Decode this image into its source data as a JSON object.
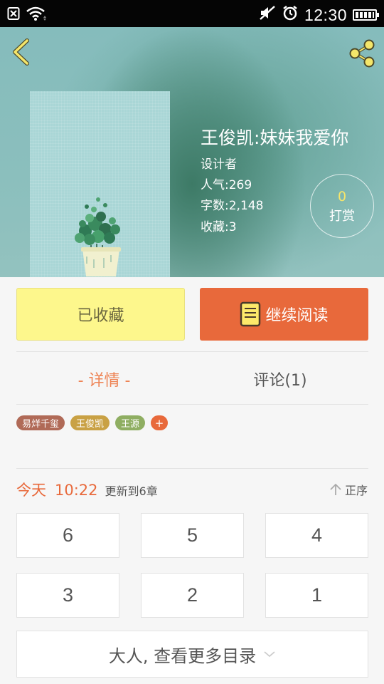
{
  "status_bar": {
    "time": "12:30",
    "icons": [
      "notification-icon",
      "wifi-icon",
      "mute-icon",
      "alarm-icon",
      "battery-icon"
    ]
  },
  "header": {
    "back_icon": "chevron-left-icon",
    "share_icon": "share-icon"
  },
  "book": {
    "title": "王俊凯:妹妹我爱你",
    "author": "设计者",
    "popularity": "人气:269",
    "word_count": "字数:2,148",
    "favorites": "收藏:3",
    "reward_count": "0",
    "reward_label": "打赏"
  },
  "actions": {
    "collected_label": "已收藏",
    "continue_label": "继续阅读",
    "continue_icon": "book-icon"
  },
  "tabs": [
    {
      "label": "- 详情 -",
      "active": true
    },
    {
      "label": "评论(1)",
      "active": false
    }
  ],
  "tags": [
    {
      "label": "易烊千玺",
      "color": "#b06a57"
    },
    {
      "label": "王俊凯",
      "color": "#c9a144"
    },
    {
      "label": "王源",
      "color": "#8fae62"
    }
  ],
  "tag_add_label": "+",
  "update": {
    "day": "今天",
    "time": "10:22",
    "text": "更新到6章",
    "sort_label": "正序",
    "sort_icon": "arrow-up-icon"
  },
  "chapters": [
    "6",
    "5",
    "4",
    "3",
    "2",
    "1"
  ],
  "more_label": "大人, 查看更多目录",
  "colors": {
    "accent": "#e8693b",
    "collected_bg": "#fdf78c",
    "tab_active": "#ee8455",
    "reward_number": "#f7e66a"
  }
}
